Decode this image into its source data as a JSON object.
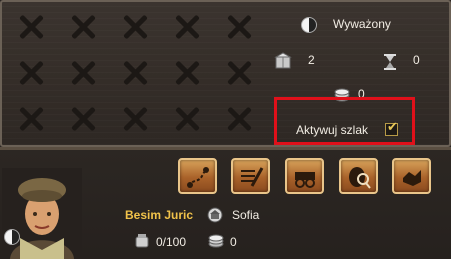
{
  "route_panel": {
    "balance_label": "Wyważony",
    "goods_count": "2",
    "hourglass_count": "0",
    "coins_count": "0",
    "activate_route_label": "Aktywuj szlak",
    "activate_route_checked": true
  },
  "toolbar": {
    "buttons": [
      {
        "icon": "route-map-icon"
      },
      {
        "icon": "edit-list-icon"
      },
      {
        "icon": "cart-icon"
      },
      {
        "icon": "barrel-search-icon"
      },
      {
        "icon": "trade-icon"
      }
    ]
  },
  "trader": {
    "name": "Besim Juric",
    "city": "Sofia",
    "cargo": "0/100",
    "money": "0"
  },
  "colors": {
    "highlight": "#e0101a",
    "name": "#f0c24a",
    "button": "#b86e30"
  }
}
